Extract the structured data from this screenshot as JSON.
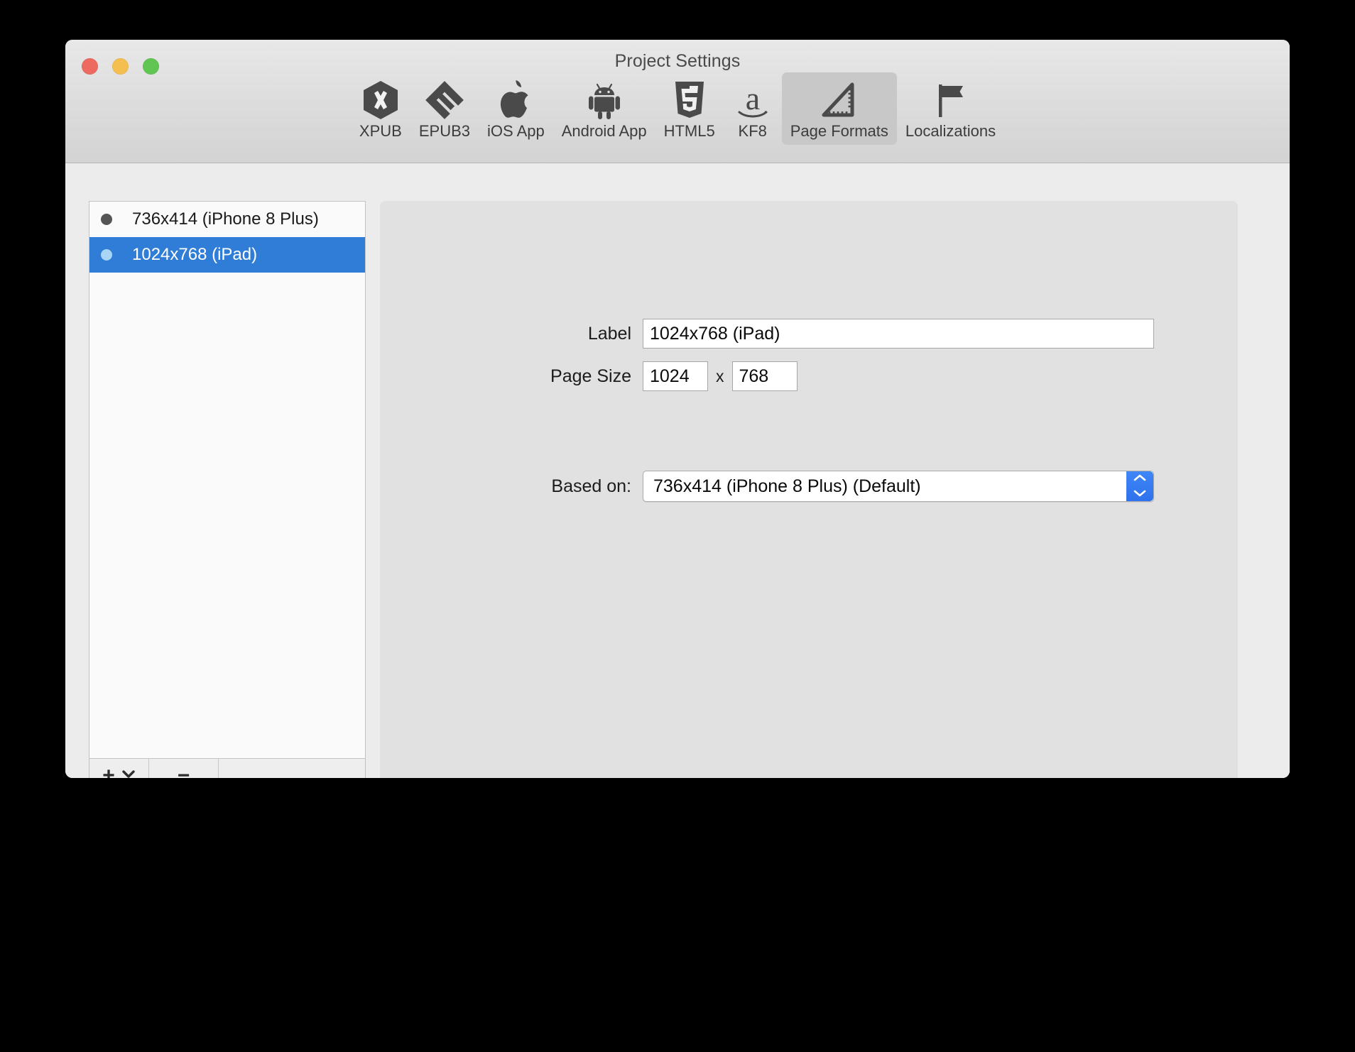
{
  "window": {
    "title": "Project Settings",
    "traffic_lights": [
      {
        "name": "close",
        "color": "#ec6a5f"
      },
      {
        "name": "minimize",
        "color": "#f4bf4f"
      },
      {
        "name": "zoom",
        "color": "#61c554"
      }
    ]
  },
  "toolbar": {
    "items": [
      {
        "label": "XPUB",
        "icon": "xpub-hexagon-icon",
        "selected": false
      },
      {
        "label": "EPUB3",
        "icon": "epub3-icon",
        "selected": false
      },
      {
        "label": "iOS App",
        "icon": "apple-icon",
        "selected": false
      },
      {
        "label": "Android App",
        "icon": "android-icon",
        "selected": false
      },
      {
        "label": "HTML5",
        "icon": "html5-shield-icon",
        "selected": false
      },
      {
        "label": "KF8",
        "icon": "amazon-icon",
        "selected": false
      },
      {
        "label": "Page Formats",
        "icon": "set-square-icon",
        "selected": true
      },
      {
        "label": "Localizations",
        "icon": "flag-icon",
        "selected": false
      }
    ]
  },
  "sidebar": {
    "rows": [
      {
        "label": "736x414 (iPhone 8 Plus)",
        "dot_color": "#555555",
        "selected": false
      },
      {
        "label": "1024x768 (iPad)",
        "dot_color": "#a8d4f5",
        "selected": true
      }
    ],
    "footer": {
      "add_label": "+",
      "add_chevron": "chevron-down-icon",
      "remove_label": "−"
    }
  },
  "detail": {
    "label_field": {
      "label": "Label",
      "value": "1024x768 (iPad)"
    },
    "page_size": {
      "label": "Page Size",
      "width": "1024",
      "separator": "x",
      "height": "768"
    },
    "based_on": {
      "label": "Based on:",
      "value": "736x414 (iPhone 8 Plus) (Default)"
    }
  },
  "colors": {
    "selection_blue": "#2f7dd6",
    "stepper_blue": "#3478f6",
    "window_bg": "#ececec",
    "panel_bg": "#e1e1e1"
  }
}
